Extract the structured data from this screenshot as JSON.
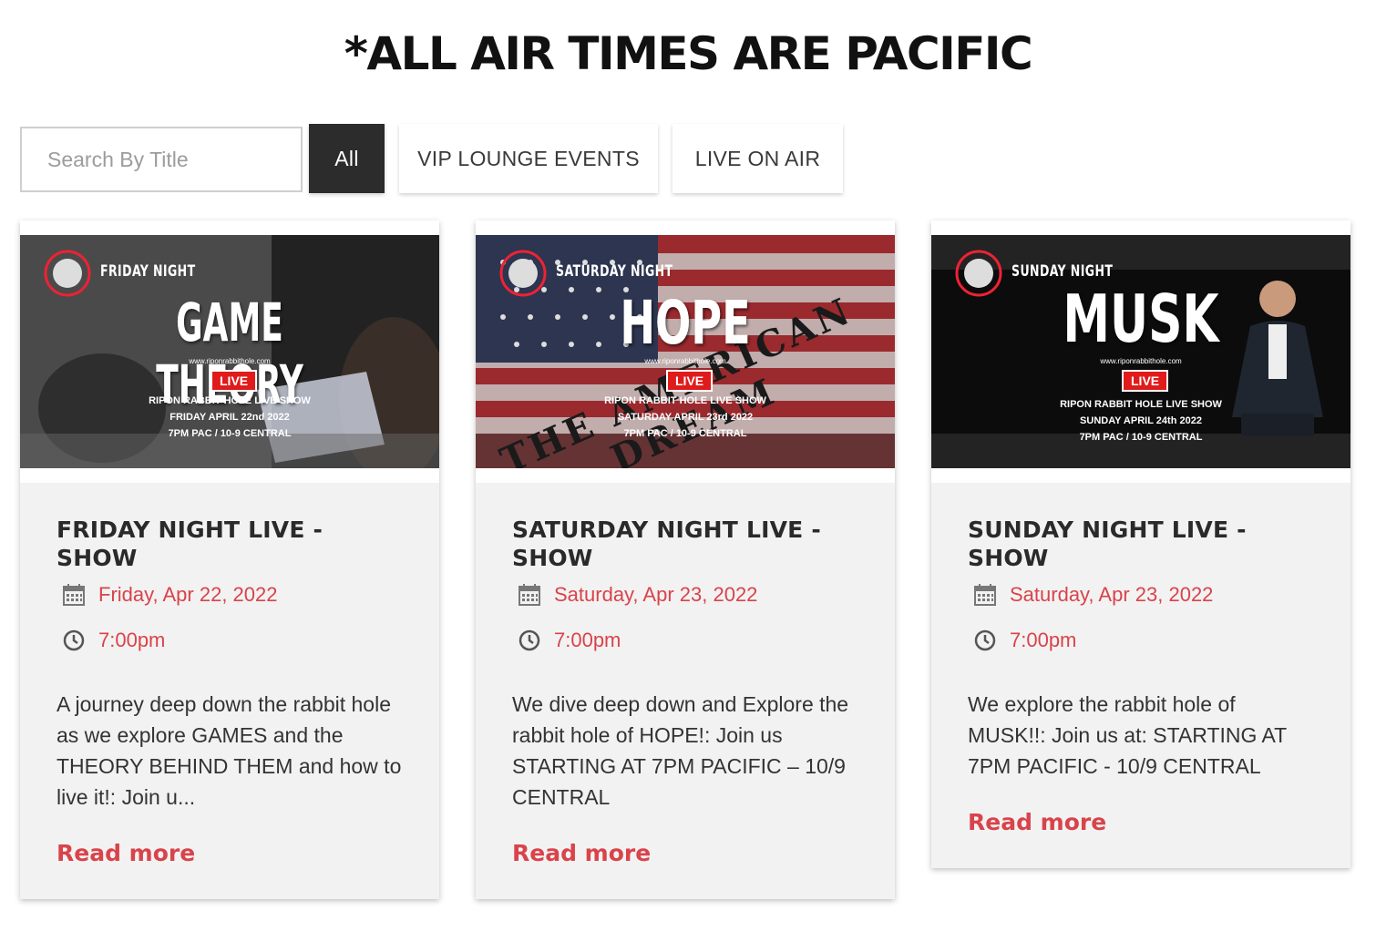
{
  "header": {
    "title": "*ALL AIR TIMES ARE PACIFIC"
  },
  "filters": {
    "search_placeholder": "Search By Title",
    "buttons": [
      "All",
      "VIP LOUNGE EVENTS",
      "LIVE ON AIR"
    ],
    "active": "All"
  },
  "colors": {
    "accent": "#d9434a",
    "active_button": "#2c2c2c",
    "card_bg": "#f2f2f2"
  },
  "events": [
    {
      "title": "FRIDAY NIGHT LIVE - SHOW",
      "date": "Friday, Apr 22, 2022",
      "time": "7:00pm",
      "description": "A journey deep down the rabbit hole as we explore GAMES and the THEORY BEHIND THEM and how to live it!: Join u...",
      "read_more": "Read more",
      "poster": {
        "night": "FRIDAY NIGHT",
        "headline": "GAME THEORY",
        "url": "www.riponrabbithole.com",
        "live": "LIVE",
        "line1": "RIPON RABBIT HOLE LIVE SHOW",
        "line2": "FRIDAY APRIL 22nd 2022",
        "line3": "7PM PAC / 10-9 CENTRAL"
      }
    },
    {
      "title": "SATURDAY NIGHT LIVE - SHOW",
      "date": "Saturday, Apr 23, 2022",
      "time": "7:00pm",
      "description": "We dive deep down and Explore the rabbit hole of HOPE!: Join us STARTING AT 7PM PACIFIC – 10/9 CENTRAL",
      "read_more": "Read more",
      "poster": {
        "night": "SATURDAY NIGHT",
        "headline": "HOPE",
        "overlay": "THE AMERICAN DREAM",
        "url": "www.riponrabbithole.com",
        "live": "LIVE",
        "line1": "RIPON RABBIT HOLE LIVE SHOW",
        "line2": "SATURDAY APRIL 23rd 2022",
        "line3": "7PM PAC / 10-9 CENTRAL"
      }
    },
    {
      "title": "SUNDAY NIGHT LIVE - SHOW",
      "date": "Saturday, Apr 23, 2022",
      "time": "7:00pm",
      "description": "We explore the rabbit hole of MUSK!!: Join us at: STARTING AT 7PM PACIFIC - 10/9 CENTRAL",
      "read_more": "Read more",
      "poster": {
        "night": "SUNDAY NIGHT",
        "headline": "MUSK",
        "url": "www.riponrabbithole.com",
        "live": "LIVE",
        "line1": "RIPON RABBIT HOLE LIVE SHOW",
        "line2": "SUNDAY APRIL 24th 2022",
        "line3": "7PM PAC / 10-9 CENTRAL"
      }
    }
  ]
}
